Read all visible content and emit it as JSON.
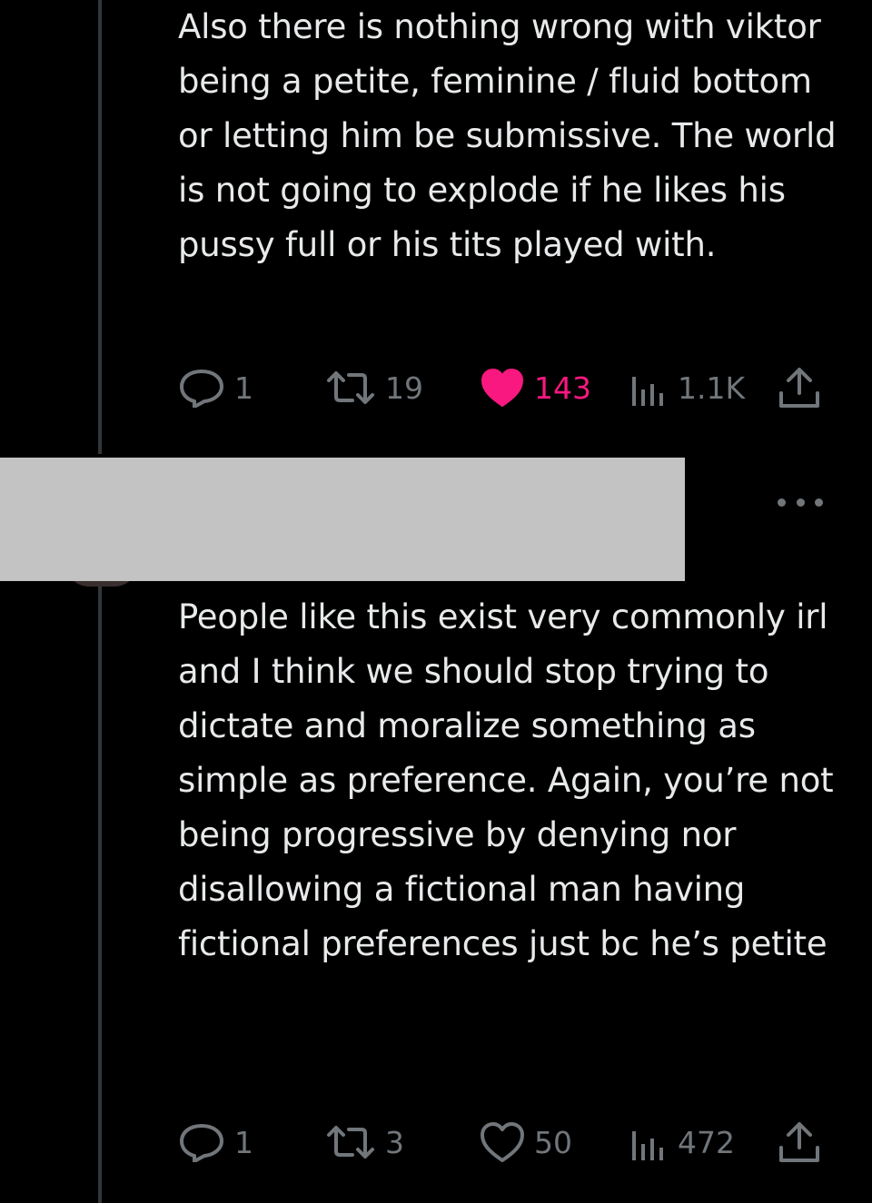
{
  "tweet1": {
    "text": "Also there is nothing wrong with viktor being a petite, feminine / fluid bottom or letting him be submissive. The world is not going to explode if he likes his pussy full or his tits played with.",
    "replies": "1",
    "reposts": "19",
    "likes": "143",
    "liked": true,
    "views": "1.1K"
  },
  "tweet2": {
    "text": "People like this exist very commonly irl and I think we should stop trying to dictate and moralize something as simple as preference. Again, you’re not being progressive by denying nor disallowing a fictional man having fictional preferences just bc he’s petite",
    "replies": "1",
    "reposts": "3",
    "likes": "50",
    "liked": false,
    "views": "472"
  },
  "icons": {
    "reply": "reply-icon",
    "repost": "repost-icon",
    "like": "heart-icon",
    "views": "views-icon",
    "share": "share-icon",
    "more": "more-icon"
  },
  "colors": {
    "background": "#000000",
    "text": "#e7e9ea",
    "muted": "#71767b",
    "like_active": "#f91880",
    "redaction": "#c3c3c3"
  }
}
